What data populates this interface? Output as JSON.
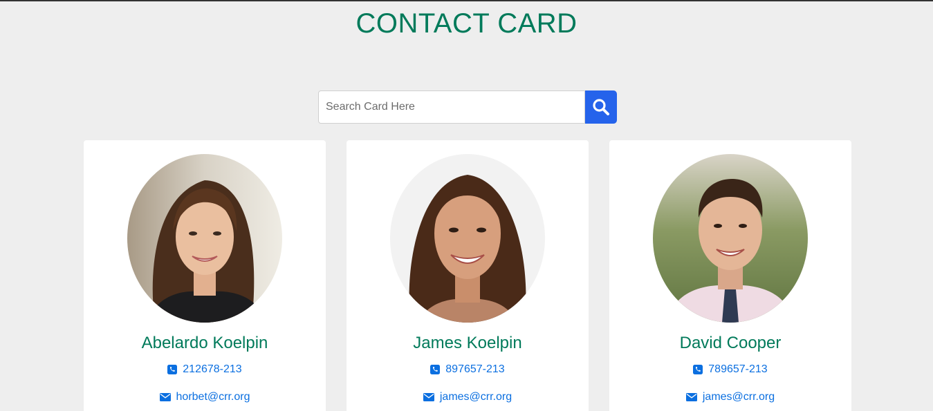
{
  "header": {
    "title": "CONTACT CARD"
  },
  "search": {
    "placeholder": "Search Card Here",
    "value": "",
    "button_icon": "search-icon",
    "button_color": "#2563eb"
  },
  "contacts": [
    {
      "name": "Abelardo Koelpin",
      "phone": "212678-213",
      "email": "horbet@crr.org",
      "avatar": "woman-with-long-brown-hair-photo"
    },
    {
      "name": "James Koelpin",
      "phone": "897657-213",
      "email": "james@crr.org",
      "avatar": "smiling-woman-with-pulled-back-hair-photo"
    },
    {
      "name": "David Cooper",
      "phone": "789657-213",
      "email": "james@crr.org",
      "avatar": "man-in-shirt-and-tie-photo"
    }
  ],
  "colors": {
    "title": "#007a5a",
    "link": "#0b6fe0",
    "background": "#eeeeee",
    "card": "#ffffff"
  }
}
